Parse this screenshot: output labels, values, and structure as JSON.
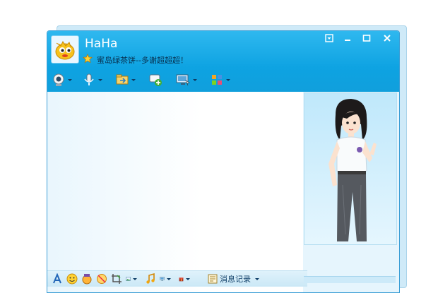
{
  "contact": {
    "name": "HaHa",
    "signature": "蜜岛绿茶饼--多谢超超超！"
  },
  "colors": {
    "title_bar": "#0ea3e2",
    "chat_bg": "#e9f6fd",
    "border": "#3d9fd6"
  },
  "window_controls": [
    "menu-icon",
    "minimize-icon",
    "maximize-icon",
    "close-icon"
  ],
  "top_toolbar": [
    "video-call-icon",
    "voice-call-icon",
    "send-file-icon",
    "create-group-icon",
    "remote-assist-icon",
    "apps-icon"
  ],
  "bottom_toolbar": {
    "icons": [
      "font-icon",
      "emoticon-icon",
      "magic-emoticon-icon",
      "nudge-icon",
      "screenshot-icon",
      "image-icon",
      "music-icon",
      "screen-share-icon",
      "gift-icon"
    ],
    "message_log_label": "消息记录"
  }
}
